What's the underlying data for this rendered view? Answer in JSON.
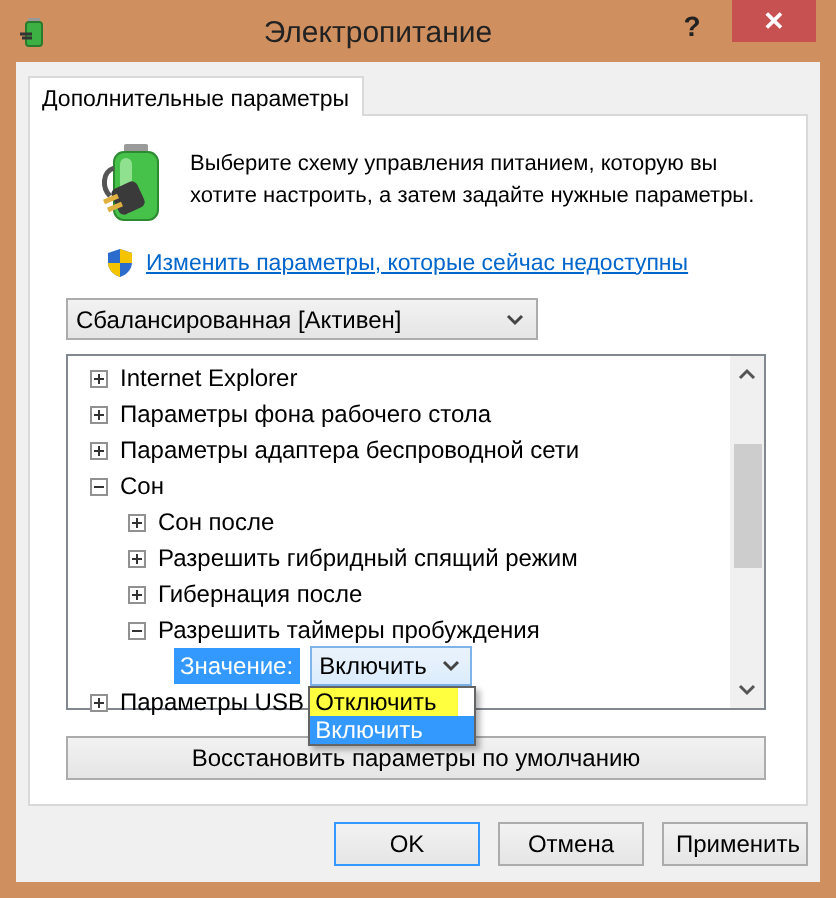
{
  "window": {
    "title": "Электропитание",
    "help": "?",
    "close": "✕"
  },
  "tabs": [
    {
      "label": "Дополнительные параметры",
      "selected": true
    }
  ],
  "intro": "Выберите схему управления питанием, которую вы хотите настроить, а затем задайте нужные параметры.",
  "admin_link": "Изменить параметры, которые сейчас недоступны",
  "plan_select": {
    "value": "Сбалансированная [Активен]"
  },
  "tree": [
    {
      "label": "Internet Explorer",
      "kind": "group",
      "expanded": false
    },
    {
      "label": "Параметры фона рабочего стола",
      "kind": "group",
      "expanded": false
    },
    {
      "label": "Параметры адаптера беспроводной сети",
      "kind": "group",
      "expanded": false
    },
    {
      "label": "Сон",
      "kind": "group",
      "expanded": true,
      "children": [
        {
          "label": "Сон после",
          "kind": "group",
          "expanded": false
        },
        {
          "label": "Разрешить гибридный спящий режим",
          "kind": "group",
          "expanded": false
        },
        {
          "label": "Гибернация после",
          "kind": "group",
          "expanded": false
        },
        {
          "label": "Разрешить таймеры пробуждения",
          "kind": "group",
          "expanded": true,
          "children": [
            {
              "kind": "setting",
              "label": "Значение:",
              "value": "Включить",
              "open": true,
              "options": [
                {
                  "label": "Отключить",
                  "selected": false,
                  "highlighted": true
                },
                {
                  "label": "Включить",
                  "selected": true,
                  "highlighted": false
                }
              ]
            }
          ]
        }
      ]
    },
    {
      "label": "Параметры USB",
      "kind": "group",
      "expanded": false
    }
  ],
  "restore_button": "Восстановить параметры по умолчанию",
  "buttons": [
    {
      "label": "OK",
      "default": true
    },
    {
      "label": "Отмена",
      "default": false
    },
    {
      "label": "Применить",
      "default": false
    }
  ]
}
